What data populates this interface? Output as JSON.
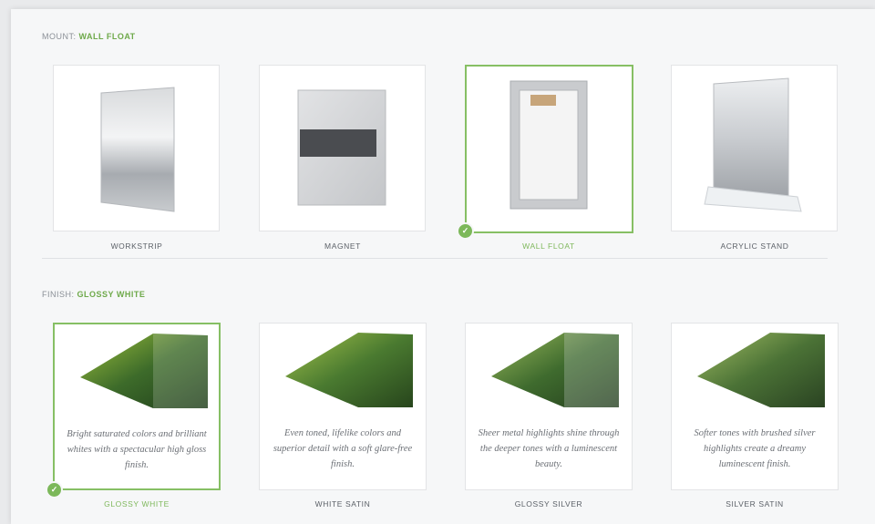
{
  "mount": {
    "label": "MOUNT:",
    "selected": "WALL FLOAT",
    "options": [
      {
        "label": "WORKSTRIP"
      },
      {
        "label": "MAGNET"
      },
      {
        "label": "WALL FLOAT"
      },
      {
        "label": "ACRYLIC STAND"
      }
    ]
  },
  "finish": {
    "label": "FINISH:",
    "selected": "GLOSSY WHITE",
    "options": [
      {
        "label": "GLOSSY WHITE",
        "description": "Bright saturated colors and brilliant whites with a spectacular high gloss finish."
      },
      {
        "label": "WHITE SATIN",
        "description": "Even toned, lifelike colors and superior detail with a soft glare-free finish."
      },
      {
        "label": "GLOSSY SILVER",
        "description": "Sheer metal highlights shine through the deeper tones with a luminescent beauty."
      },
      {
        "label": "SILVER SATIN",
        "description": "Softer tones with brushed silver highlights create a dreamy luminescent finish."
      }
    ]
  },
  "colors": {
    "accent": "#7cb85a",
    "card_border": "#e3e4e6",
    "background": "#f6f7f8"
  },
  "icons": {
    "check": "check-icon"
  }
}
